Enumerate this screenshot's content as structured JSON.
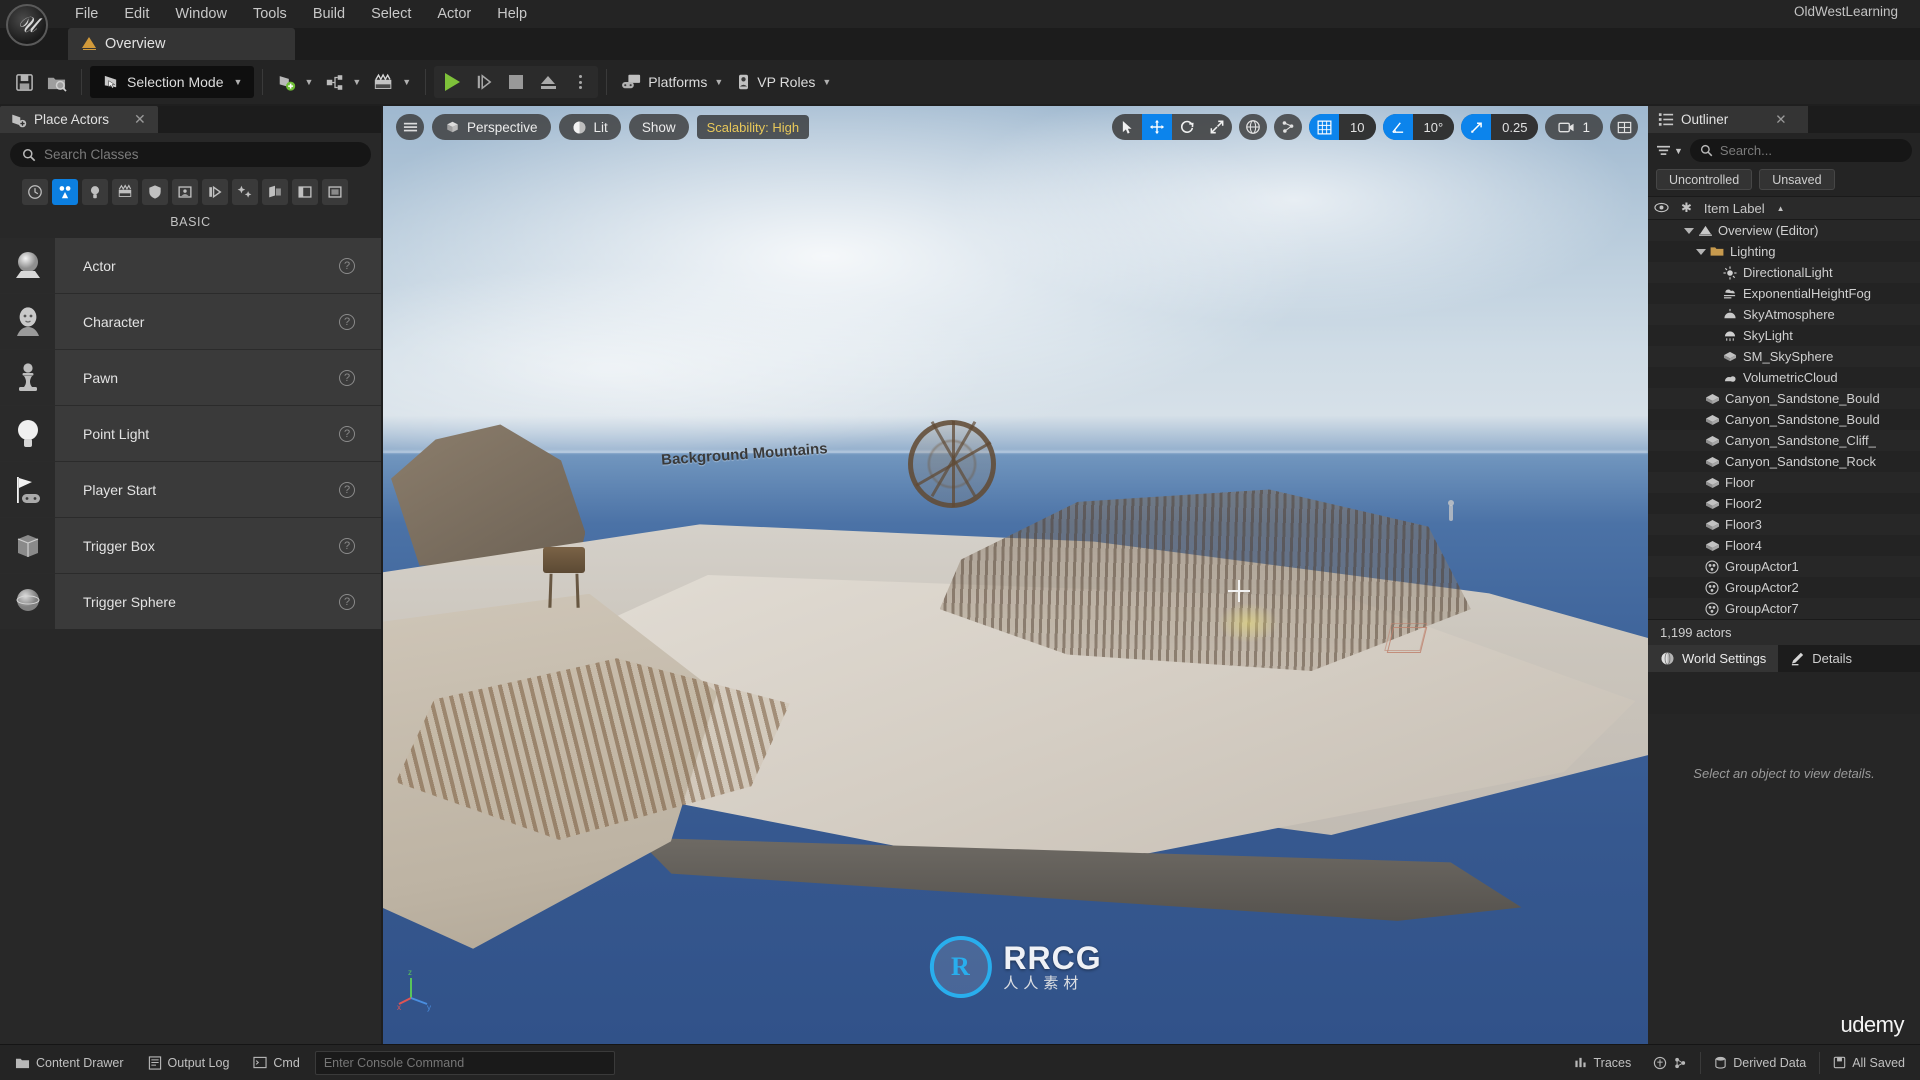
{
  "menubar": {
    "logo_icon": "unreal-engine-logo",
    "items": [
      "File",
      "Edit",
      "Window",
      "Tools",
      "Build",
      "Select",
      "Actor",
      "Help"
    ],
    "project_name": "OldWestLearning"
  },
  "tabbar": {
    "level_tab": {
      "label": "Overview",
      "icon": "level-triangle-icon"
    }
  },
  "toolbar": {
    "save_icon": "save-icon",
    "browse_icon": "browse-content-icon",
    "mode_label": "Selection Mode",
    "mode_icon": "selection-mode-icon",
    "add_icon": "add-actor-icon",
    "blueprint_icon": "blueprints-icon",
    "cinematics_icon": "cinematics-icon",
    "play_icon": "play-icon",
    "skip_icon": "skip-frame-icon",
    "stop_icon": "stop-icon",
    "eject_icon": "eject-icon",
    "more_icon": "more-options-icon",
    "platforms_label": "Platforms",
    "platforms_icon": "platforms-icon",
    "vproles_label": "VP Roles",
    "vproles_icon": "vp-roles-icon"
  },
  "place_actors": {
    "tab_label": "Place Actors",
    "tab_icon": "place-actors-icon",
    "close_icon": "close-icon",
    "search": {
      "placeholder": "Search Classes",
      "value": "",
      "icon": "search-icon"
    },
    "categories": [
      {
        "name": "recently-placed",
        "icon": "clock-icon",
        "active": false
      },
      {
        "name": "basic",
        "icon": "basic-shapes-icon",
        "active": true
      },
      {
        "name": "lights",
        "icon": "light-bulb-icon",
        "active": false
      },
      {
        "name": "cinematic",
        "icon": "clapperboard-icon",
        "active": false
      },
      {
        "name": "visual-effects",
        "icon": "shield-icon",
        "active": false
      },
      {
        "name": "geometry",
        "icon": "box-icon",
        "active": false
      },
      {
        "name": "volumes",
        "icon": "volume-icon",
        "active": false
      },
      {
        "name": "all-classes",
        "icon": "sparkles-icon",
        "active": false
      },
      {
        "name": "shapes",
        "icon": "shapes-icon",
        "active": false
      },
      {
        "name": "panels",
        "icon": "panel-icon",
        "active": false
      },
      {
        "name": "more",
        "icon": "more-icon",
        "active": false
      }
    ],
    "section_label": "BASIC",
    "items": [
      {
        "label": "Actor",
        "icon": "actor-sphere-icon",
        "help": "?"
      },
      {
        "label": "Character",
        "icon": "character-head-icon",
        "help": "?"
      },
      {
        "label": "Pawn",
        "icon": "pawn-icon",
        "help": "?"
      },
      {
        "label": "Point Light",
        "icon": "point-light-icon",
        "help": "?"
      },
      {
        "label": "Player Start",
        "icon": "player-start-icon",
        "help": "?"
      },
      {
        "label": "Trigger Box",
        "icon": "trigger-box-icon",
        "help": "?"
      },
      {
        "label": "Trigger Sphere",
        "icon": "trigger-sphere-icon",
        "help": "?"
      }
    ]
  },
  "viewport": {
    "menu_icon": "viewport-menu-icon",
    "perspective_label": "Perspective",
    "perspective_icon": "camera-cube-icon",
    "lit_label": "Lit",
    "lit_icon": "lit-sphere-icon",
    "show_label": "Show",
    "scalability_label": "Scalability: High",
    "scalability_color": "#e8c85a",
    "accent_color": "#0c84ec",
    "transform_tools": [
      {
        "name": "select-tool",
        "icon": "cursor-arrow-icon",
        "active": false
      },
      {
        "name": "move-tool",
        "icon": "move-gizmo-icon",
        "active": true
      },
      {
        "name": "rotate-tool",
        "icon": "rotate-gizmo-icon",
        "active": false
      },
      {
        "name": "scale-tool",
        "icon": "scale-gizmo-icon",
        "active": false
      }
    ],
    "coord_icon": "world-globe-icon",
    "surface_snap_icon": "surface-snap-icon",
    "grid_snap": {
      "icon": "grid-snap-icon",
      "value": "10",
      "enabled": true
    },
    "angle_snap": {
      "icon": "angle-snap-icon",
      "value": "10°",
      "enabled": true
    },
    "scale_snap": {
      "icon": "scale-snap-icon",
      "value": "0.25",
      "enabled": true
    },
    "camera_speed": {
      "icon": "camera-speed-icon",
      "value": "1"
    },
    "layout_icon": "viewport-layout-icon",
    "scene_label": "Background Mountains",
    "axis_labels": [
      "X",
      "Y",
      "Z"
    ]
  },
  "outliner": {
    "tab_label": "Outliner",
    "tab_icon": "outliner-icon",
    "close_icon": "close-icon",
    "filter_icon": "filter-icon",
    "search": {
      "placeholder": "Search...",
      "value": "",
      "icon": "search-icon"
    },
    "chips": [
      "Uncontrolled",
      "Unsaved"
    ],
    "columns": {
      "visibility_icon": "eye-icon",
      "pinned_icon": "star-icon",
      "item_label": "Item Label",
      "sort_icon": "sort-ascending-icon"
    },
    "rows": [
      {
        "label": "Overview (Editor)",
        "icon": "level-triangle-icon",
        "indent": 1,
        "expander": true
      },
      {
        "label": "Lighting",
        "icon": "folder-icon",
        "indent": 2,
        "expander": true
      },
      {
        "label": "DirectionalLight",
        "icon": "directional-light-icon",
        "indent": 3,
        "expander": false
      },
      {
        "label": "ExponentialHeightFog",
        "icon": "fog-icon",
        "indent": 3,
        "expander": false
      },
      {
        "label": "SkyAtmosphere",
        "icon": "sky-atmosphere-icon",
        "indent": 3,
        "expander": false
      },
      {
        "label": "SkyLight",
        "icon": "sky-light-icon",
        "indent": 3,
        "expander": false
      },
      {
        "label": "SM_SkySphere",
        "icon": "static-mesh-icon",
        "indent": 3,
        "expander": false
      },
      {
        "label": "VolumetricCloud",
        "icon": "volumetric-cloud-icon",
        "indent": 3,
        "expander": false
      },
      {
        "label": "Canyon_Sandstone_Bould",
        "icon": "static-mesh-icon",
        "indent": 2,
        "expander": false
      },
      {
        "label": "Canyon_Sandstone_Bould",
        "icon": "static-mesh-icon",
        "indent": 2,
        "expander": false
      },
      {
        "label": "Canyon_Sandstone_Cliff_",
        "icon": "static-mesh-icon",
        "indent": 2,
        "expander": false
      },
      {
        "label": "Canyon_Sandstone_Rock",
        "icon": "static-mesh-icon",
        "indent": 2,
        "expander": false
      },
      {
        "label": "Floor",
        "icon": "static-mesh-icon",
        "indent": 2,
        "expander": false
      },
      {
        "label": "Floor2",
        "icon": "static-mesh-icon",
        "indent": 2,
        "expander": false
      },
      {
        "label": "Floor3",
        "icon": "static-mesh-icon",
        "indent": 2,
        "expander": false
      },
      {
        "label": "Floor4",
        "icon": "static-mesh-icon",
        "indent": 2,
        "expander": false
      },
      {
        "label": "GroupActor1",
        "icon": "group-actor-icon",
        "indent": 2,
        "expander": false
      },
      {
        "label": "GroupActor2",
        "icon": "group-actor-icon",
        "indent": 2,
        "expander": false
      },
      {
        "label": "GroupActor7",
        "icon": "group-actor-icon",
        "indent": 2,
        "expander": false
      }
    ],
    "actor_count": "1,199 actors"
  },
  "details": {
    "world_settings_label": "World Settings",
    "world_settings_icon": "globe-icon",
    "details_label": "Details",
    "details_icon": "details-pencil-icon",
    "empty_hint": "Select an object to view details."
  },
  "statusbar": {
    "content_drawer": {
      "label": "Content Drawer",
      "icon": "content-drawer-icon"
    },
    "output_log": {
      "label": "Output Log",
      "icon": "output-log-icon"
    },
    "cmd": {
      "label": "Cmd",
      "icon": "cmd-icon"
    },
    "console": {
      "placeholder": "Enter Console Command",
      "value": ""
    },
    "right_items": [
      {
        "label": "Traces",
        "icon": "traces-icon"
      },
      {
        "label": "Derived Data",
        "icon": "derived-data-icon"
      },
      {
        "label": "All Saved",
        "icon": "all-saved-icon"
      }
    ]
  },
  "watermark": {
    "logo_text": "R",
    "brand_top": "RRCG",
    "brand_bottom": "人人素材",
    "udemy": "udemy"
  }
}
